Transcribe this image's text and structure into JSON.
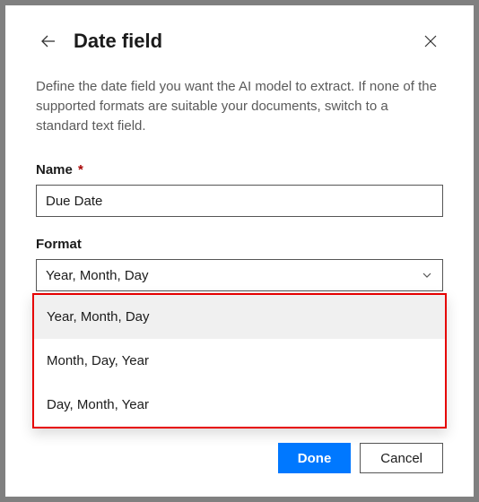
{
  "header": {
    "title": "Date field"
  },
  "description": "Define the date field you want the AI model to extract. If none of the supported formats are suitable your documents, switch to a standard text field.",
  "nameField": {
    "label": "Name",
    "required": "*",
    "value": "Due Date"
  },
  "formatField": {
    "label": "Format",
    "selectedValue": "Year, Month, Day",
    "options": [
      "Year, Month, Day",
      "Month, Day, Year",
      "Day, Month, Year"
    ]
  },
  "footer": {
    "done": "Done",
    "cancel": "Cancel"
  }
}
